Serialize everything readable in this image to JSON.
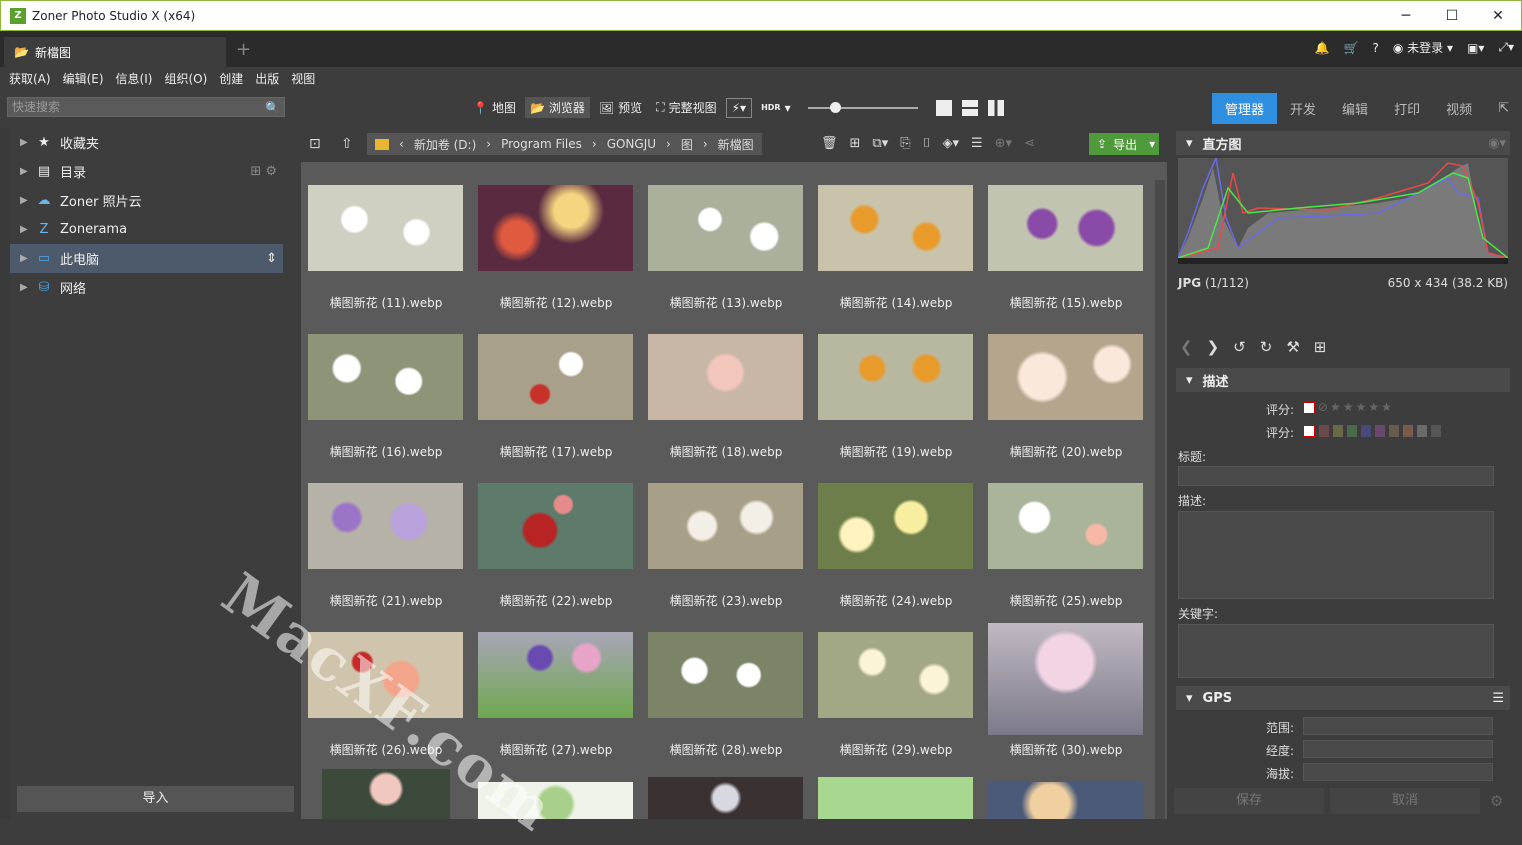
{
  "window": {
    "title": "Zoner Photo Studio X (x64)"
  },
  "tab": {
    "label": "新檔图"
  },
  "account": {
    "status": "未登录"
  },
  "menu": [
    "获取(A)",
    "编辑(E)",
    "信息(I)",
    "组织(O)",
    "创建",
    "出版",
    "视图"
  ],
  "search": {
    "placeholder": "快速搜索"
  },
  "view_modes": [
    {
      "label": "地图",
      "icon": "pin-icon"
    },
    {
      "label": "浏览器",
      "icon": "folder-open-icon"
    },
    {
      "label": "预览",
      "icon": "image-icon"
    },
    {
      "label": "完整视图",
      "icon": "fullscreen-icon"
    }
  ],
  "hdr_label": "HDR",
  "modules": [
    "管理器",
    "开发",
    "编辑",
    "打印",
    "视频"
  ],
  "nav": [
    {
      "label": "收藏夹",
      "icon": "star-icon"
    },
    {
      "label": "目录",
      "icon": "catalog-icon"
    },
    {
      "label": "Zoner 照片云",
      "icon": "cloud-icon"
    },
    {
      "label": "Zonerama",
      "icon": "zonerama-icon"
    },
    {
      "label": "此电脑",
      "icon": "monitor-icon"
    },
    {
      "label": "网络",
      "icon": "network-icon"
    }
  ],
  "import_label": "导入",
  "path": [
    "新加卷 (D:)",
    "Program Files",
    "GONGJU",
    "图",
    "新檔图"
  ],
  "export_label": "导出",
  "files": [
    {
      "name": "横图新花 (11).webp",
      "color": "#cfd0c2"
    },
    {
      "name": "横图新花 (12).webp",
      "color": "#a8453a"
    },
    {
      "name": "横图新花 (13).webp",
      "color": "#c9ccbe"
    },
    {
      "name": "横图新花 (14).webp",
      "color": "#c49a52"
    },
    {
      "name": "横图新花 (15).webp",
      "color": "#a992b6"
    },
    {
      "name": "横图新花 (16).webp",
      "color": "#b9bfae"
    },
    {
      "name": "横图新花 (17).webp",
      "color": "#b8ab99"
    },
    {
      "name": "横图新花 (18).webp",
      "color": "#c8b7a7"
    },
    {
      "name": "横图新花 (19).webp",
      "color": "#c59b54"
    },
    {
      "name": "横图新花 (20).webp",
      "color": "#d4c1ad"
    },
    {
      "name": "横图新花 (21).webp",
      "color": "#a99cb8"
    },
    {
      "name": "横图新花 (22).webp",
      "color": "#5d7a6a"
    },
    {
      "name": "横图新花 (23).webp",
      "color": "#c3b7a0"
    },
    {
      "name": "横图新花 (24).webp",
      "color": "#c4bb76"
    },
    {
      "name": "横图新花 (25).webp",
      "color": "#c6cdb9"
    },
    {
      "name": "横图新花 (26).webp",
      "color": "#d0b59c"
    },
    {
      "name": "横图新花 (27).webp",
      "color": "#8e9c86"
    },
    {
      "name": "横图新花 (28).webp",
      "color": "#b3b6a4"
    },
    {
      "name": "横图新花 (29).webp",
      "color": "#b9bd9b"
    },
    {
      "name": "横图新花 (30).webp",
      "color": "#c1b9c2"
    }
  ],
  "histogram": {
    "title": "直方图"
  },
  "file_info": {
    "type": "JPG",
    "index": "(1/112)",
    "dims": "650 x 434 (38.2 KB)"
  },
  "describe": {
    "title": "描述",
    "rating1": "评分:",
    "rating2": "评分:",
    "title_label": "标题:",
    "desc_label": "描述:",
    "keywords_label": "关键字:"
  },
  "gps": {
    "title": "GPS",
    "range": "范围:",
    "lng": "经度:",
    "alt": "海拔:"
  },
  "actions": {
    "save": "保存",
    "cancel": "取消"
  },
  "watermark": "MacXF.com"
}
